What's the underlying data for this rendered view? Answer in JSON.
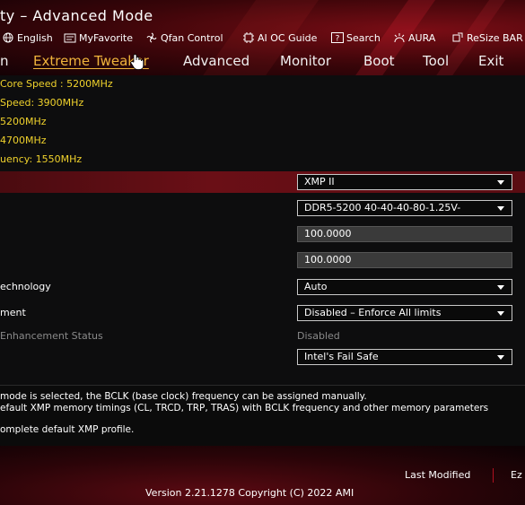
{
  "window": {
    "title": "ty – Advanced Mode"
  },
  "toolbar": {
    "items": [
      {
        "label": "English",
        "icon": "globe-icon"
      },
      {
        "label": "MyFavorite",
        "icon": "favorite-icon"
      },
      {
        "label": "Qfan Control",
        "icon": "fan-icon"
      },
      {
        "label": "AI OC Guide",
        "icon": "ai-icon"
      },
      {
        "label": "Search",
        "icon": "search-icon"
      },
      {
        "label": "AURA",
        "icon": "aura-icon"
      },
      {
        "label": "ReSize BAR",
        "icon": "resize-icon"
      }
    ]
  },
  "menu": {
    "items": [
      "n",
      "Extreme Tweaker",
      "Advanced",
      "Monitor",
      "Boot",
      "Tool",
      "Exit"
    ],
    "active_index": 1
  },
  "info": [
    "Core Speed : 5200MHz",
    "Speed: 3900MHz",
    "5200MHz",
    "4700MHz",
    "uency: 1550MHz"
  ],
  "settings": [
    {
      "label": "",
      "value": "XMP II",
      "kind": "dropdown",
      "highlight": true
    },
    {
      "label": "",
      "value": "DDR5-5200 40-40-40-80-1.25V-",
      "kind": "dropdown"
    },
    {
      "label": "",
      "value": "100.0000",
      "kind": "number"
    },
    {
      "label": "",
      "value": "100.0000",
      "kind": "number"
    },
    {
      "label": "echnology",
      "value": "Auto",
      "kind": "dropdown"
    },
    {
      "label": "ment",
      "value": "Disabled – Enforce All limits",
      "kind": "dropdown"
    },
    {
      "label": "Enhancement Status",
      "value": "Disabled",
      "kind": "static"
    },
    {
      "label": "",
      "value": "Intel's Fail Safe",
      "kind": "dropdown"
    }
  ],
  "help": [
    " mode is selected, the BCLK (base clock) frequency can be assigned manually.",
    "efault XMP memory timings (CL, TRCD, TRP, TRAS) with BCLK frequency and other memory parameters",
    "omplete default XMP profile."
  ],
  "footer": {
    "last_modified": "Last Modified",
    "ezmode": "Ez",
    "version": "Version 2.21.1278 Copyright (C) 2022 AMI"
  },
  "colors": {
    "accent": "#f0b43c",
    "info_text": "#f0d22c",
    "highlight_row": "#6a0f16"
  }
}
